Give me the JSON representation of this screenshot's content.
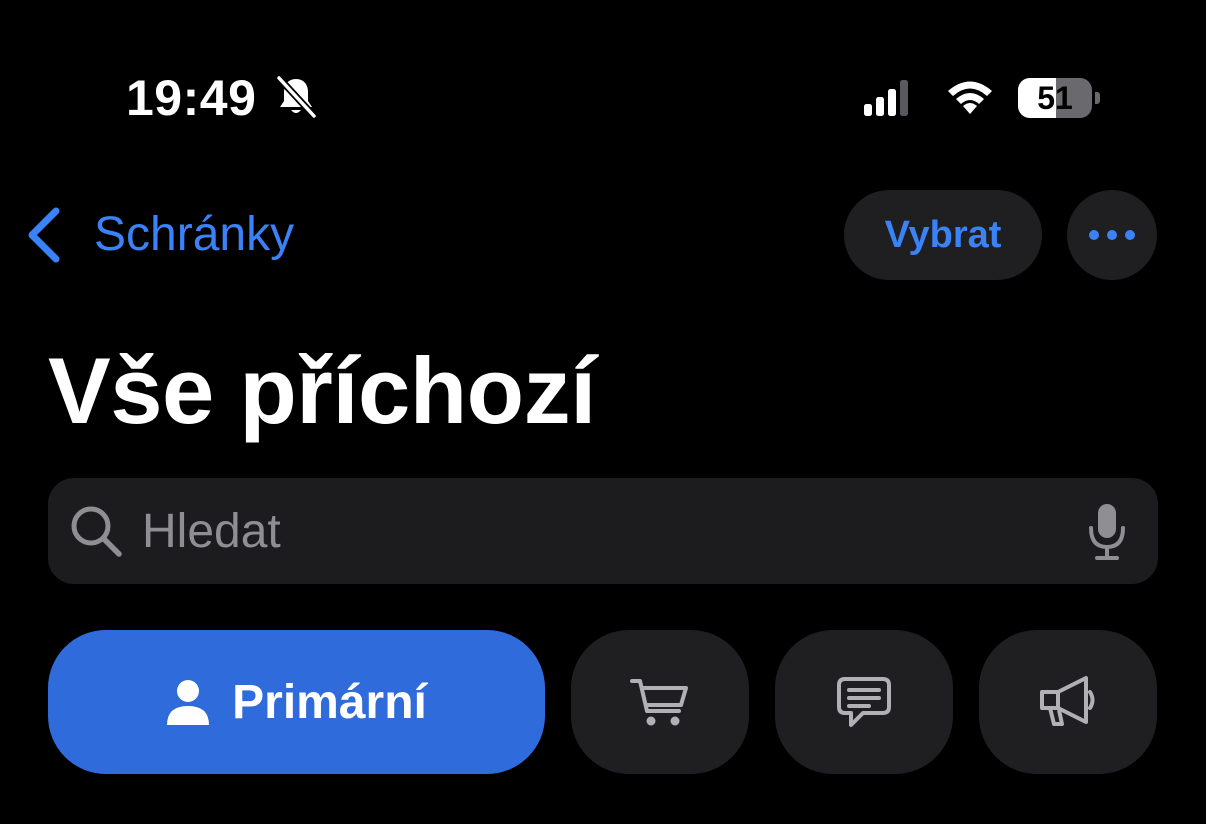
{
  "status_bar": {
    "time": "19:49",
    "silent_icon": "bell-slash-icon",
    "battery_level": "51",
    "battery_fraction": 0.51,
    "signal_icon": "cellular-signal-icon",
    "wifi_icon": "wifi-icon"
  },
  "nav": {
    "back_label": "Schránky",
    "select_label": "Vybrat",
    "more_icon": "ellipsis-icon"
  },
  "title": "Vše příchozí",
  "search": {
    "placeholder": "Hledat",
    "value": ""
  },
  "categories": [
    {
      "label": "Primární",
      "icon": "person-icon",
      "selected": true
    },
    {
      "label": "",
      "icon": "cart-icon",
      "selected": false
    },
    {
      "label": "",
      "icon": "message-icon",
      "selected": false
    },
    {
      "label": "",
      "icon": "megaphone-icon",
      "selected": false
    }
  ],
  "colors": {
    "background": "#000000",
    "accent": "#3a82f7",
    "chip_selected": "#2f6bda",
    "chip": "#1f1f21",
    "search_field": "#1c1c1e",
    "placeholder": "#8e8e93"
  }
}
